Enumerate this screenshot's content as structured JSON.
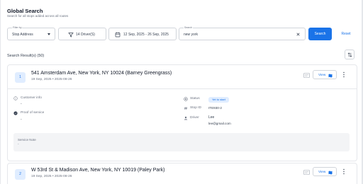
{
  "header": {
    "title": "Global Search",
    "subtitle": "Search for all stops added across all routes"
  },
  "filters": {
    "filter_by": {
      "label": "Filter by",
      "value": "Stop Address"
    },
    "drivers": {
      "value": "14 Driver(S)"
    },
    "date_range": {
      "value": "12 Sep, 2025 - 26 Sep, 2025"
    },
    "search": {
      "label": "Search",
      "value": "new york"
    }
  },
  "actions": {
    "search_label": "Search",
    "reset_label": "Reset"
  },
  "results": {
    "label": "Search Result(s) (50)",
    "items": [
      {
        "number": "1",
        "address": "541 Amsterdam Ave, New York, NY 10024 (Barney Greengrass)",
        "date": "19 Sep, 2025 • 2025-08-26",
        "view_label": "View",
        "customer_info_label": "Customer info",
        "customer_info_value": "-",
        "proof_label": "Proof of service",
        "proof_value": "-",
        "status_label": "Status",
        "status_value": "Yet to start",
        "stop_id_label": "Stop ID",
        "stop_id_value": "ITE930-2",
        "driver_label": "Driver",
        "driver_name": "Lee",
        "driver_email": "lee@gmail.com",
        "service_note_label": "Service Note",
        "service_note_value": "-"
      },
      {
        "number": "2",
        "address": "W 53rd St & Madison Ave, New York, NY 10019 (Paley Park)",
        "date": "19 Sep, 2025 • 2025-08-26",
        "view_label": "View"
      }
    ]
  },
  "colors": {
    "accent": "#1a73e8",
    "badge_bg": "#e0edff"
  },
  "icons": [
    "chevron-down-icon",
    "filter-icon",
    "calendar-icon",
    "close-icon",
    "sort-icon",
    "message-icon",
    "map-icon",
    "more-vertical-icon",
    "info-icon",
    "check-circle-icon",
    "status-dot-icon",
    "hash-icon",
    "user-icon"
  ]
}
